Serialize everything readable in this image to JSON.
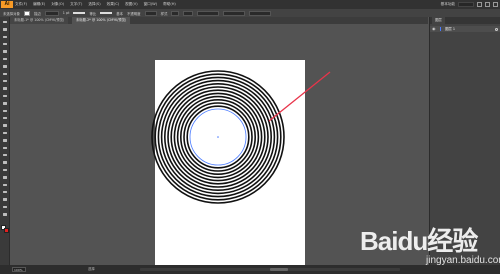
{
  "app": {
    "logo": "Ai"
  },
  "menu": [
    "文件(F)",
    "编辑(E)",
    "对象(O)",
    "文字(T)",
    "选择(S)",
    "效果(C)",
    "视图(V)",
    "窗口(W)",
    "帮助(H)"
  ],
  "menubar_right": {
    "workspace": "基本功能"
  },
  "control_bar": {
    "items": [
      "未选择对象",
      "描边",
      "1 pt",
      "等比",
      "基本",
      "不透明度",
      "样式"
    ]
  },
  "tabs": [
    {
      "label": "未标题-1* @ 100% (CMYK/预览)",
      "active": false
    },
    {
      "label": "未标题-2* @ 100% (CMYK/预览)",
      "active": true
    }
  ],
  "tools": [
    "selection-tool-icon",
    "direct-selection-tool-icon",
    "magic-wand-icon",
    "lasso-icon",
    "pen-tool-icon",
    "type-tool-icon",
    "line-tool-icon",
    "rectangle-tool-icon",
    "paintbrush-icon",
    "pencil-icon",
    "eraser-icon",
    "rotate-tool-icon",
    "scale-tool-icon",
    "width-tool-icon",
    "free-transform-icon",
    "shape-builder-icon",
    "perspective-grid-icon",
    "mesh-tool-icon",
    "gradient-tool-icon",
    "eyedropper-icon",
    "blend-tool-icon",
    "symbol-sprayer-icon",
    "graph-tool-icon",
    "artboard-tool-icon",
    "slice-tool-icon",
    "hand-tool-icon",
    "zoom-tool-icon"
  ],
  "colors": {
    "fill": "#ffffff",
    "stroke": "#e02020",
    "arrow": "#e8344a",
    "selection": "#4a7bff"
  },
  "layers_panel": {
    "tab": "图层",
    "layers": [
      {
        "name": "图层 1"
      }
    ]
  },
  "status_bar": {
    "zoom": "100%",
    "tool": "选择"
  },
  "artwork": {
    "ring_count": 12
  },
  "watermark": {
    "brand": "Baidu经验",
    "url": "jingyan.baidu.com"
  }
}
